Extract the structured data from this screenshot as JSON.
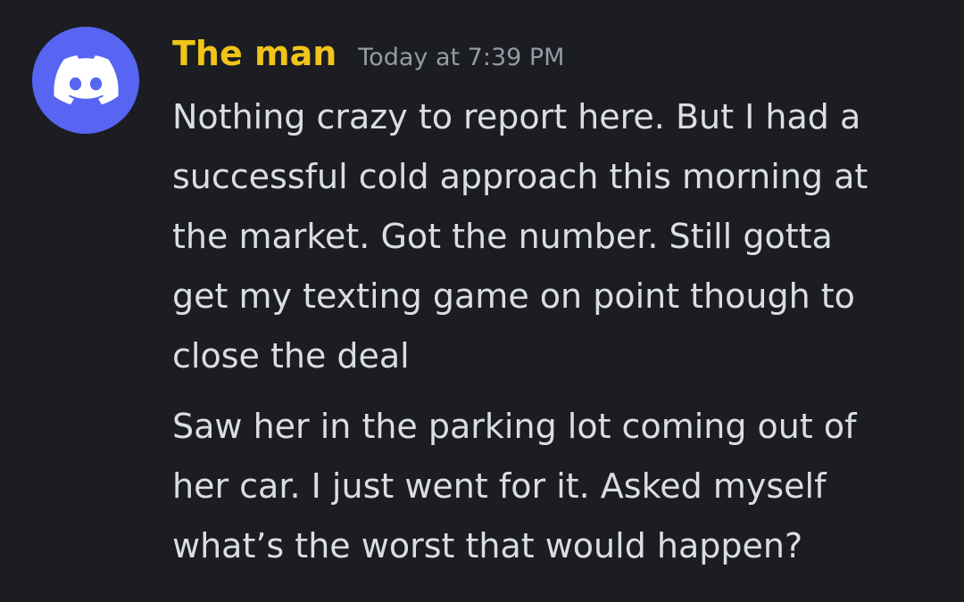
{
  "message": {
    "author": "The man",
    "timestamp": "Today at 7:39 PM",
    "avatar_icon": "discord-logo-icon",
    "colors": {
      "background": "#1c1d22",
      "avatar_bg": "#5865f2",
      "username": "#f0c419",
      "timestamp": "#949ba4",
      "text": "#dbdee1"
    },
    "paragraph1": [
      "Nothing crazy to report here. But I had a",
      "successful cold approach this morning at",
      "the market. Got the number. Still gotta",
      "get my texting game on point though to",
      "close the deal"
    ],
    "paragraph2": [
      "Saw her in the parking lot coming out of",
      "her car. I just went for it. Asked myself",
      "what’s the worst that would happen?"
    ]
  }
}
